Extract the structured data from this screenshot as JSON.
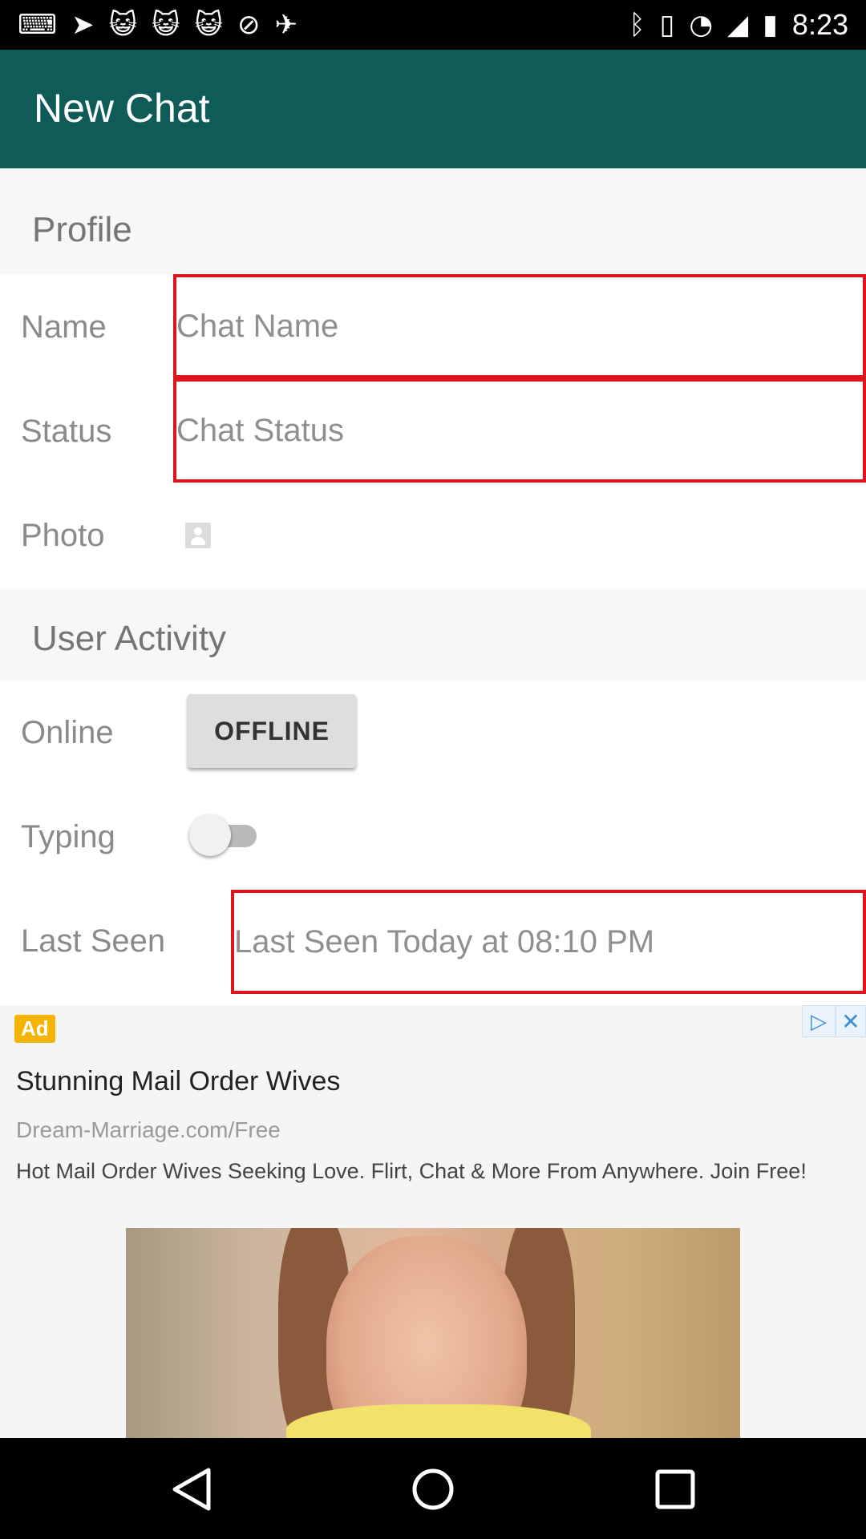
{
  "status_bar": {
    "time": "8:23",
    "left_icons": [
      "keyboard-icon",
      "navigation-icon",
      "cat-icon",
      "cat-icon",
      "cat-icon",
      "blocked-icon",
      "satellite-icon"
    ],
    "right_icons": [
      "bluetooth-icon",
      "vibrate-icon",
      "wifi-icon",
      "signal-icon",
      "battery-icon"
    ]
  },
  "app_bar": {
    "title": "New Chat"
  },
  "profile": {
    "section_title": "Profile",
    "name_label": "Name",
    "name_placeholder": "Chat Name",
    "status_label": "Status",
    "status_placeholder": "Chat Status",
    "photo_label": "Photo"
  },
  "user_activity": {
    "section_title": "User Activity",
    "online_label": "Online",
    "online_button": "OFFLINE",
    "typing_label": "Typing",
    "typing_on": false,
    "last_seen_label": "Last Seen",
    "last_seen_value": "Last Seen Today at 08:10 PM"
  },
  "ad": {
    "badge": "Ad",
    "headline": "Stunning Mail Order Wives",
    "url": "Dream-Marriage.com/Free",
    "description": "Hot Mail Order Wives Seeking Love. Flirt, Chat & More From Anywhere. Join Free!"
  },
  "colors": {
    "app_bar": "#0e5b57",
    "input_border": "#e0141b",
    "ad_badge": "#f4b400"
  }
}
